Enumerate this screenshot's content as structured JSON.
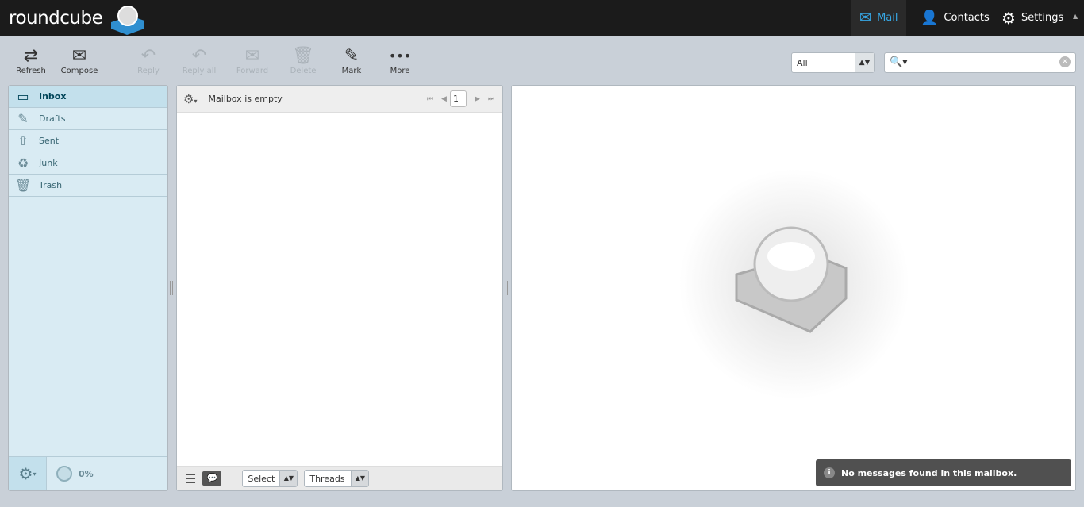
{
  "header": {
    "logo": "roundcube",
    "nav": [
      {
        "label": "Mail",
        "icon": "mail-icon"
      },
      {
        "label": "Contacts",
        "icon": "person-icon"
      },
      {
        "label": "Settings",
        "icon": "gear-icon"
      }
    ]
  },
  "toolbar": {
    "buttons": [
      {
        "label": "Refresh",
        "glyph": "⇄",
        "enabled": true
      },
      {
        "label": "Compose",
        "glyph": "✉",
        "enabled": true
      },
      {
        "label": "Reply",
        "glyph": "↶",
        "enabled": false
      },
      {
        "label": "Reply all",
        "glyph": "↶",
        "enabled": false
      },
      {
        "label": "Forward",
        "glyph": "✉",
        "enabled": false
      },
      {
        "label": "Delete",
        "glyph": "🗑",
        "enabled": false
      },
      {
        "label": "Mark",
        "glyph": "✎",
        "enabled": true
      },
      {
        "label": "More",
        "glyph": "•••",
        "enabled": true
      }
    ]
  },
  "filter": {
    "value": "All"
  },
  "search": {
    "placeholder": ""
  },
  "folders": [
    {
      "label": "Inbox",
      "glyph": "▭"
    },
    {
      "label": "Drafts",
      "glyph": "✎"
    },
    {
      "label": "Sent",
      "glyph": "⇧"
    },
    {
      "label": "Junk",
      "glyph": "♻"
    },
    {
      "label": "Trash",
      "glyph": "🗑"
    }
  ],
  "quota": "0%",
  "list": {
    "status": "Mailbox is empty",
    "page": "1",
    "select_label": "Select",
    "threads_label": "Threads"
  },
  "toast": "No messages found in this mailbox."
}
